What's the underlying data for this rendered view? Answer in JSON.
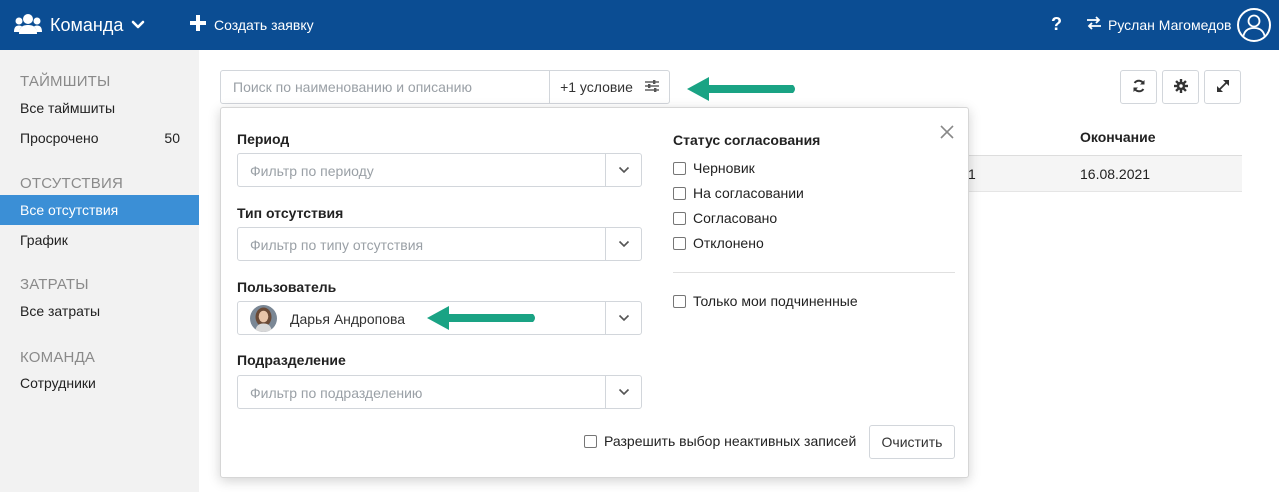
{
  "header": {
    "team_label": "Команда",
    "create_label": "Создать заявку",
    "help_label": "?",
    "user_name": "Руслан Магомедов"
  },
  "sidebar": {
    "sections": [
      {
        "title": "ТАЙМШИТЫ",
        "items": [
          {
            "label": "Все таймшиты"
          },
          {
            "label": "Просрочено",
            "count": "50"
          }
        ]
      },
      {
        "title": "ОТСУТСТВИЯ",
        "items": [
          {
            "label": "Все отсутствия",
            "active": true
          },
          {
            "label": "График"
          }
        ]
      },
      {
        "title": "ЗАТРАТЫ",
        "items": [
          {
            "label": "Все затраты"
          }
        ]
      },
      {
        "title": "КОМАНДА",
        "items": [
          {
            "label": "Сотрудники"
          }
        ]
      }
    ]
  },
  "search": {
    "placeholder": "Поиск по наименованию и описанию",
    "condition_label": "+1 условие"
  },
  "table": {
    "headers": {
      "end": "Окончание"
    },
    "row": {
      "cut_text": "1",
      "end": "16.08.2021"
    }
  },
  "filter_panel": {
    "period": {
      "label": "Период",
      "placeholder": "Фильтр по периоду"
    },
    "absence_type": {
      "label": "Тип отсутствия",
      "placeholder": "Фильтр по типу отсутствия"
    },
    "user": {
      "label": "Пользователь",
      "value": "Дарья Андропова"
    },
    "department": {
      "label": "Подразделение",
      "placeholder": "Фильтр по подразделению"
    },
    "status": {
      "title": "Статус согласования",
      "options": [
        "Черновик",
        "На согласовании",
        "Согласовано",
        "Отклонено"
      ]
    },
    "only_subordinates_label": "Только мои подчиненные",
    "allow_inactive_label": "Разрешить выбор неактивных записей",
    "clear_label": "Очистить"
  },
  "colors": {
    "header_bg": "#0b4d93",
    "active_item_bg": "#3b8fd6",
    "arrow_color": "#1aa384"
  }
}
